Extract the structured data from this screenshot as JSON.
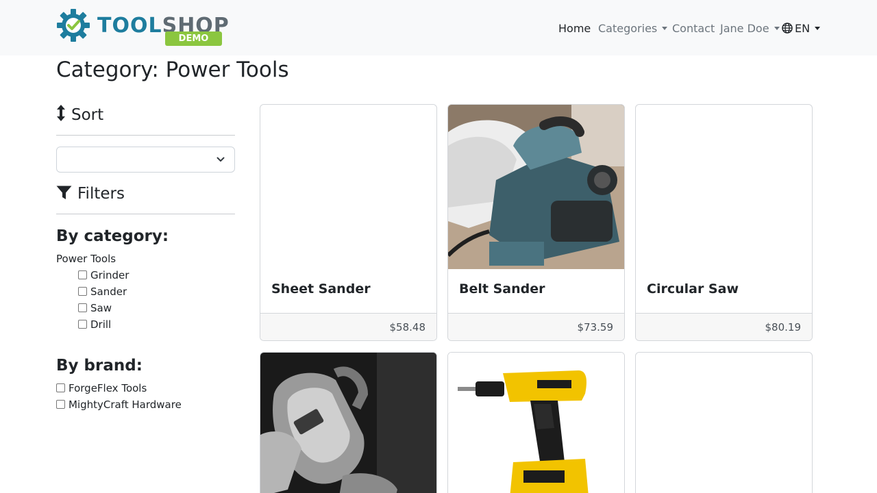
{
  "brand": {
    "name_part1": "TOOL",
    "name_part2": "SHOP",
    "badge": "DEMO",
    "primary_color": "#1e7d9e",
    "accent_color": "#8bc63f"
  },
  "nav": {
    "home": "Home",
    "categories": "Categories",
    "contact": "Contact",
    "user": "Jane Doe",
    "language": "EN"
  },
  "page": {
    "title": "Category: Power Tools"
  },
  "sidebar": {
    "sort_heading": "Sort",
    "sort_value": "",
    "filters_heading": "Filters",
    "by_category_heading": "By category:",
    "category_parent": "Power Tools",
    "categories": [
      "Grinder",
      "Sander",
      "Saw",
      "Drill"
    ],
    "by_brand_heading": "By brand:",
    "brands": [
      "ForgeFlex Tools",
      "MightyCraft Hardware"
    ]
  },
  "products": [
    {
      "name": "Sheet Sander",
      "price": "$58.48",
      "image": "none"
    },
    {
      "name": "Belt Sander",
      "price": "$73.59",
      "image": "planer-photo"
    },
    {
      "name": "Circular Saw",
      "price": "$80.19",
      "image": "none"
    },
    {
      "name": "",
      "price": "",
      "image": "orbital-sander-bw-photo"
    },
    {
      "name": "",
      "price": "",
      "image": "cordless-drill-photo"
    },
    {
      "name": "",
      "price": "",
      "image": "none"
    }
  ]
}
